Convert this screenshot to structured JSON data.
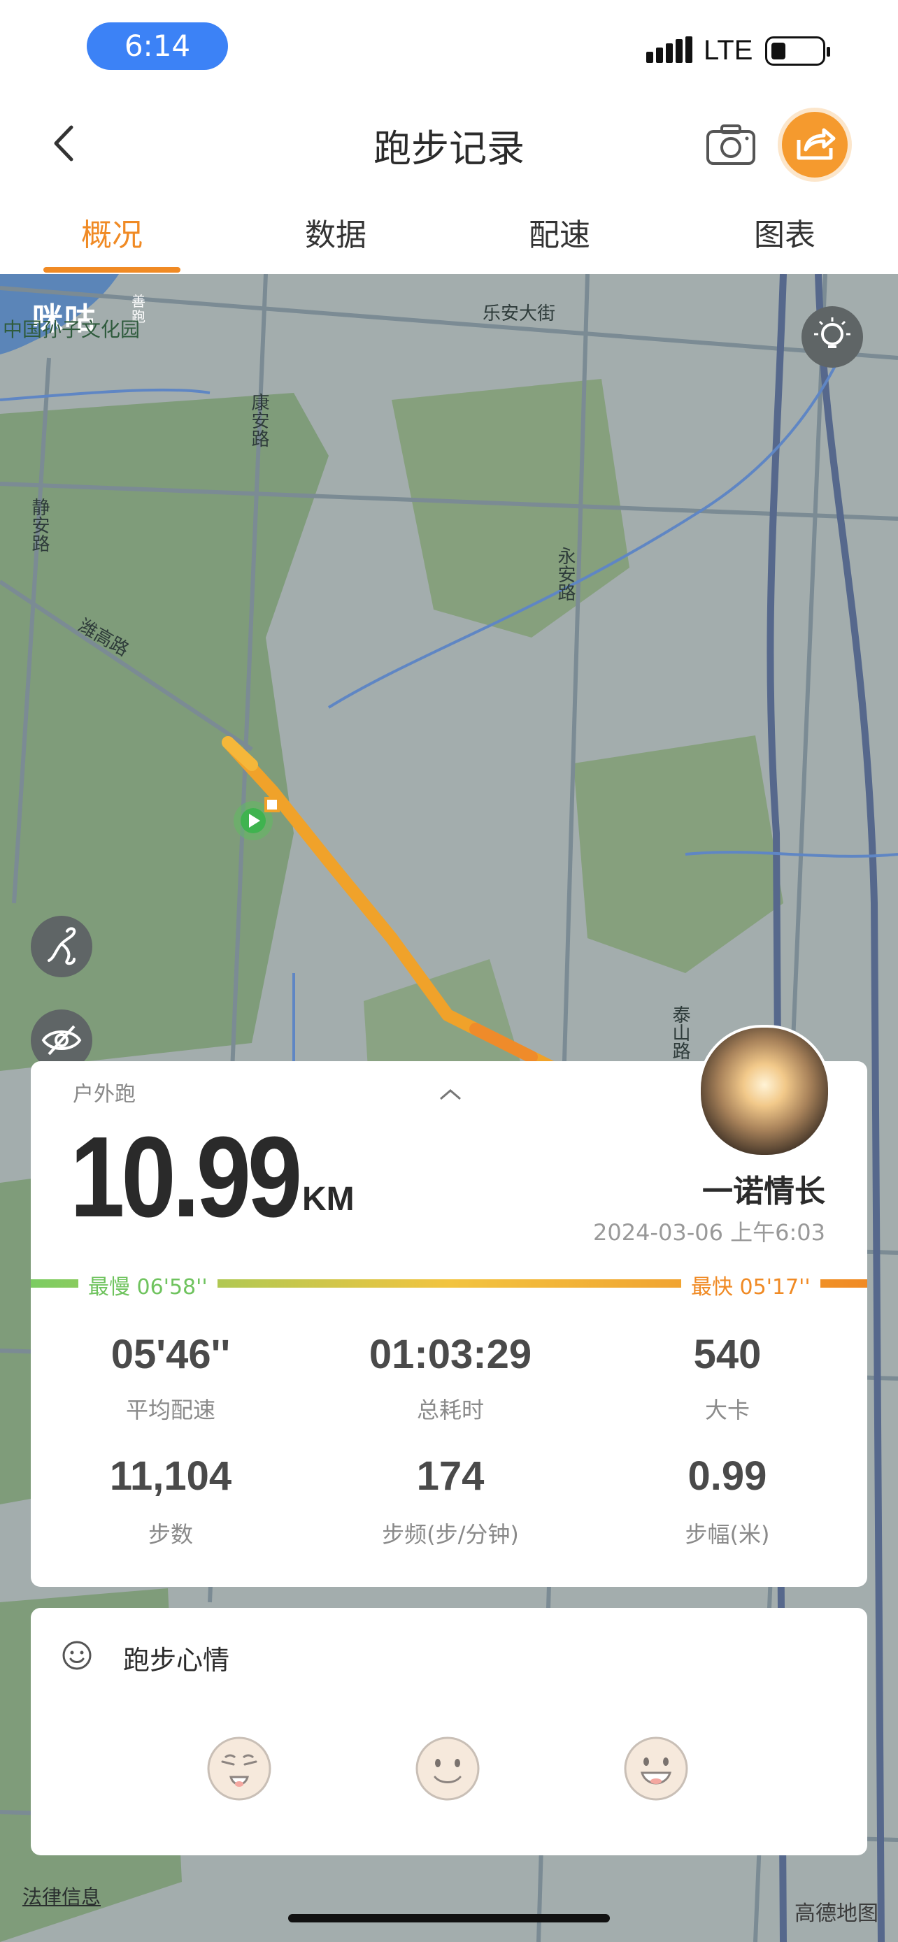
{
  "status_bar": {
    "time": "6:14",
    "network": "LTE"
  },
  "nav": {
    "title": "跑步记录"
  },
  "tabs": [
    "概况",
    "数据",
    "配速",
    "图表"
  ],
  "map": {
    "logo": "咪咕",
    "logo_sub": "善跑",
    "park_label": "中国孙子文化园",
    "roads": [
      "乐安大街",
      "康安路",
      "静安路",
      "潍高路",
      "永安路",
      "泰山路"
    ],
    "legal_link": "法律信息",
    "provider": "高德地图"
  },
  "summary": {
    "run_type": "户外跑",
    "distance": "10.99",
    "distance_unit": "KM",
    "username": "一诺情长",
    "datetime": "2024-03-06 上午6:03",
    "slowest": "最慢  06'58''",
    "fastest": "最快  05'17''",
    "stats": [
      {
        "value": "05'46''",
        "label": "平均配速"
      },
      {
        "value": "01:03:29",
        "label": "总耗时"
      },
      {
        "value": "540",
        "label": "大卡"
      },
      {
        "value": "11,104",
        "label": "步数"
      },
      {
        "value": "174",
        "label": "步频(步/分钟)"
      },
      {
        "value": "0.99",
        "label": "步幅(米)"
      }
    ]
  },
  "mood": {
    "title": "跑步心情",
    "faces": [
      "tired-face",
      "calm-face",
      "happy-face"
    ]
  },
  "colors": {
    "accent": "#f08a24",
    "slow": "#6fc35e",
    "track": "#f5a623",
    "time_pill": "#3c82f6"
  }
}
